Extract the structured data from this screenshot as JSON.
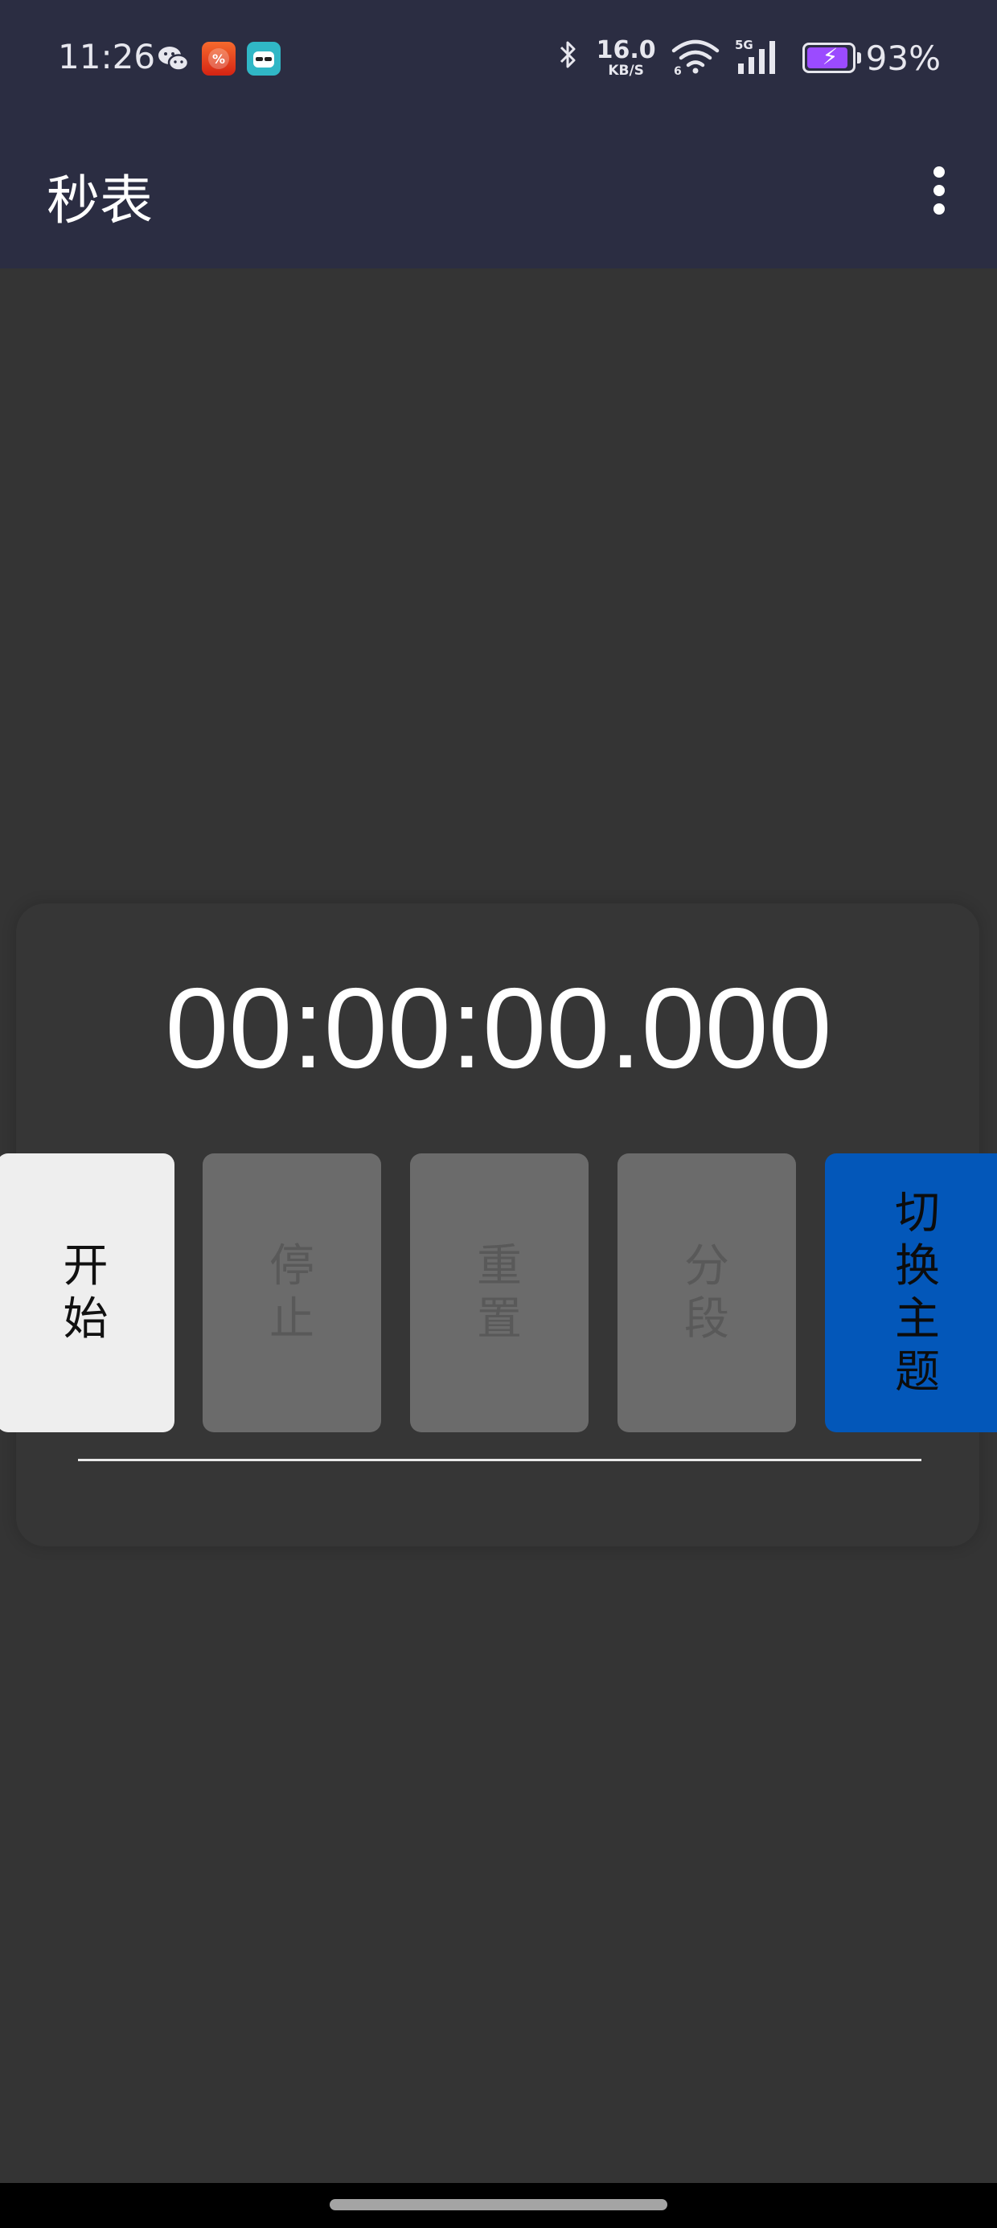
{
  "status_bar": {
    "time": "11:26",
    "net_speed_value": "16.0",
    "net_speed_unit": "KB/S",
    "wifi_label": "6",
    "mobile_label": "5G",
    "battery_percent": "93%",
    "battery_level": 0.93,
    "battery_color": "#9b4bff"
  },
  "notification_icons": [
    "wechat-icon",
    "red-app-icon",
    "magic-app-icon"
  ],
  "app_bar": {
    "title": "秒表",
    "menu_icon": "more-vert-icon",
    "background": "#2b2d42"
  },
  "stopwatch": {
    "display": "00:00:00.000"
  },
  "buttons": [
    {
      "label": "开始",
      "state": "enabled",
      "color": "#eeeeee"
    },
    {
      "label": "停止",
      "state": "disabled",
      "color": "#6b6b6b"
    },
    {
      "label": "重置",
      "state": "disabled",
      "color": "#6b6b6b"
    },
    {
      "label": "分段",
      "state": "disabled",
      "color": "#6b6b6b"
    },
    {
      "label": "切换主题",
      "state": "enabled",
      "color": "#0357b9"
    }
  ]
}
